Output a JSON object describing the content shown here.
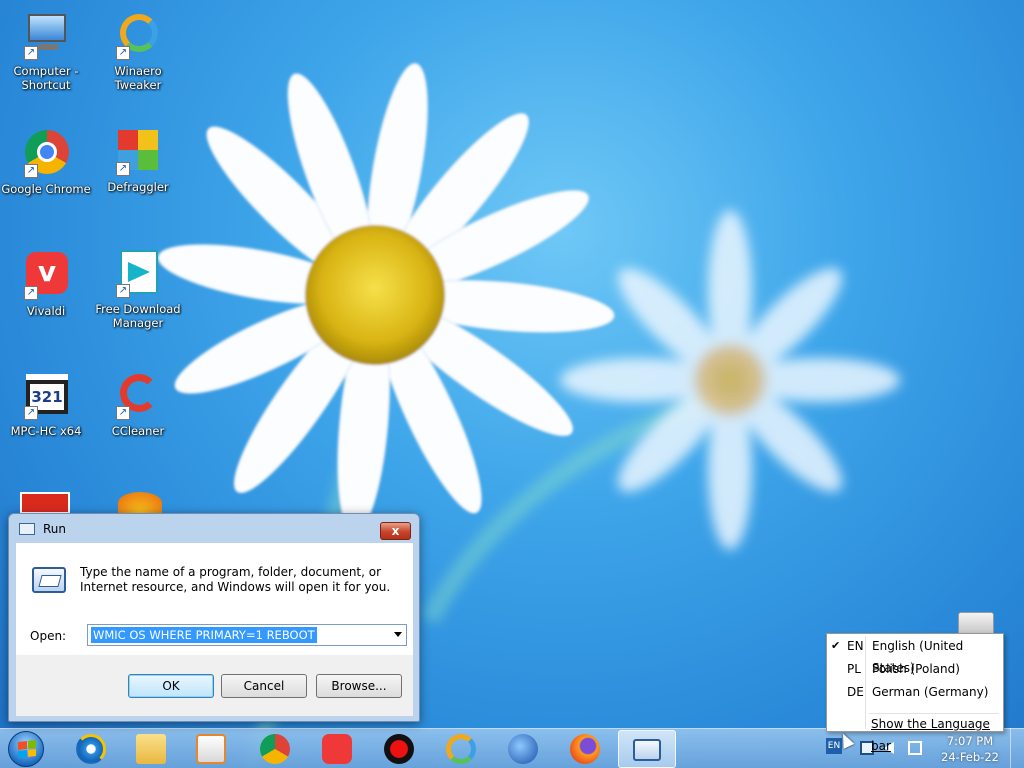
{
  "desktop": {
    "icons": [
      {
        "label_line1": "Computer -",
        "label_line2": "Shortcut"
      },
      {
        "label_line1": "Winaero",
        "label_line2": "Tweaker"
      },
      {
        "label_line1": "Google Chrome",
        "label_line2": ""
      },
      {
        "label_line1": "Defraggler",
        "label_line2": ""
      },
      {
        "label_line1": "Vivaldi",
        "label_line2": ""
      },
      {
        "label_line1": "Free Download",
        "label_line2": "Manager"
      },
      {
        "label_line1": "MPC-HC x64",
        "label_line2": ""
      },
      {
        "label_line1": "CCleaner",
        "label_line2": ""
      }
    ]
  },
  "run_dialog": {
    "title": "Run",
    "close_glyph": "x",
    "description": "Type the name of a program, folder, document, or Internet resource, and Windows will open it for you.",
    "open_label": "Open:",
    "open_value": "WMIC OS WHERE PRIMARY=1 REBOOT",
    "ok_label": "OK",
    "cancel_label": "Cancel",
    "browse_label": "Browse..."
  },
  "language_menu": {
    "items": [
      {
        "check": "✔",
        "code": "EN",
        "name": "English (United States)"
      },
      {
        "check": "",
        "code": "PL",
        "name": "Polish (Poland)"
      },
      {
        "check": "",
        "code": "DE",
        "name": "German (Germany)"
      }
    ],
    "show_bar_label": "Show the Language bar"
  },
  "taskbar": {
    "tray_lang": "EN",
    "time": "7:07 PM",
    "date": "24-Feb-22"
  },
  "colors": {
    "selection": "#3399ff",
    "close_red": "#c7442a",
    "taskbar": "#8fbfe8"
  }
}
